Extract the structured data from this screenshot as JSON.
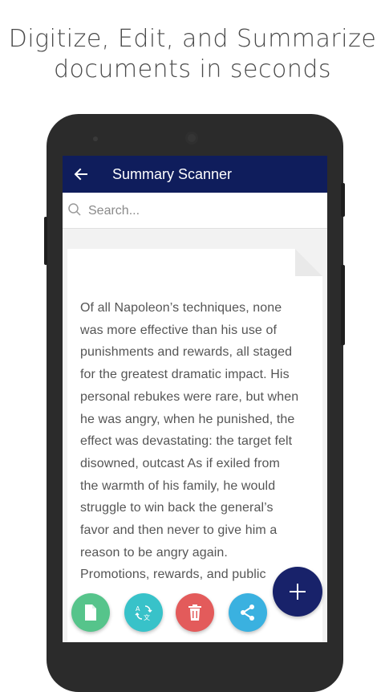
{
  "promo": {
    "line1": "Digitize, Edit, and Summarize",
    "line2": "documents in seconds"
  },
  "app": {
    "title": "Summary Scanner"
  },
  "search": {
    "placeholder": "Search..."
  },
  "document": {
    "lines": [
      "Of all Napoleon’s techniques, none",
      "was more effective than his use of",
      "punishments and rewards, all staged",
      "for the greatest dramatic impact. His",
      "personal rebukes were rare, but when",
      "he was angry, when he punished, the",
      "effect was devastating: the target felt",
      "disowned, outcast As if exiled from",
      "the warmth of his family, he would",
      "struggle to win back the general’s",
      "favor and then never to give him a",
      "reason to be angry again.",
      "Promotions, rewards, and public"
    ]
  },
  "actions": {
    "document_color": "#56c48b",
    "translate_color": "#38c2c9",
    "delete_color": "#e35b5b",
    "share_color": "#3ab1e0",
    "add_color": "#18226a"
  },
  "icons": [
    "back-arrow-icon",
    "search-icon",
    "document-icon",
    "translate-icon",
    "trash-icon",
    "share-icon",
    "plus-icon"
  ]
}
